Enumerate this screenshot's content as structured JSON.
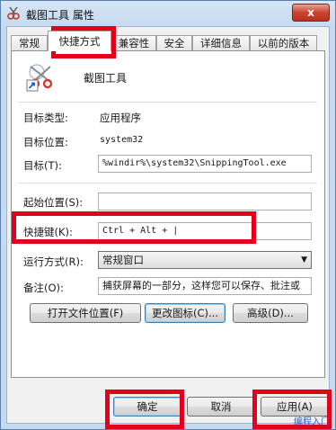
{
  "window": {
    "title": "截图工具 属性",
    "close_label": "x"
  },
  "tabs": [
    {
      "label": "常规"
    },
    {
      "label": "快捷方式"
    },
    {
      "label": "兼容性"
    },
    {
      "label": "安全"
    },
    {
      "label": "详细信息"
    },
    {
      "label": "以前的版本"
    }
  ],
  "shortcut": {
    "app_name": "截图工具",
    "target_type_label": "目标类型:",
    "target_type_value": "应用程序",
    "target_location_label": "目标位置:",
    "target_location_value": "system32",
    "target_label": "目标(T):",
    "target_value": "%windir%\\system32\\SnippingTool.exe",
    "start_in_label": "起始位置(S):",
    "start_in_value": "",
    "shortcut_key_label": "快捷键(K):",
    "shortcut_key_value": "Ctrl + Alt + |",
    "run_label": "运行方式(R):",
    "run_value": "常规窗口",
    "comment_label": "备注(O):",
    "comment_value": "捕获屏幕的一部分，这样您可以保存、批注或",
    "open_location_button": "打开文件位置(F)",
    "change_icon_button": "更改图标(C)...",
    "advanced_button": "高级(D)..."
  },
  "footer": {
    "ok_button": "确定",
    "cancel_button": "取消",
    "apply_button": "应用(A)"
  },
  "colors": {
    "highlight": "#e2001a",
    "frame": "#c5d9ef"
  },
  "icons": {
    "app_icon": "scissors-icon",
    "shortcut_overlay": "shortcut-arrow-icon"
  },
  "watermark": "编程入门"
}
